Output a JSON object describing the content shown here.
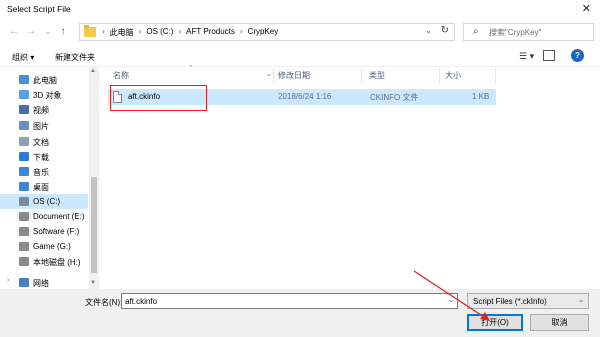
{
  "window": {
    "title": "Select Script File",
    "close_glyph": "✕"
  },
  "nav": {
    "back_glyph": "←",
    "forward_glyph": "→",
    "recent_glyph": "⌄",
    "up_glyph": "↑",
    "breadcrumbs": [
      "此电脑",
      "OS (C:)",
      "AFT Products",
      "CrypKey"
    ],
    "separator": "›",
    "dropdown_glyph": "⌄",
    "refresh_glyph": "↻",
    "search_placeholder": "搜索\"CrypKey\"",
    "search_glyph": "⌕"
  },
  "toolbar": {
    "organize_label": "组织 ▾",
    "new_folder_label": "新建文件夹",
    "views_glyph": "☰ ▾"
  },
  "sidebar": {
    "items": [
      {
        "label": "此电脑",
        "icon": "computer-icon",
        "color": "#4a90d9",
        "selected": false,
        "arrow": ""
      },
      {
        "label": "3D 对象",
        "icon": "3d-objects-icon",
        "color": "#5aa0e6",
        "selected": false,
        "arrow": ""
      },
      {
        "label": "视频",
        "icon": "video-icon",
        "color": "#4a6ea8",
        "selected": false,
        "arrow": ""
      },
      {
        "label": "图片",
        "icon": "pictures-icon",
        "color": "#6a8fbf",
        "selected": false,
        "arrow": ""
      },
      {
        "label": "文档",
        "icon": "documents-icon",
        "color": "#8ca0b8",
        "selected": false,
        "arrow": ""
      },
      {
        "label": "下载",
        "icon": "downloads-icon",
        "color": "#2b7bd8",
        "selected": false,
        "arrow": ""
      },
      {
        "label": "音乐",
        "icon": "music-icon",
        "color": "#3d86d9",
        "selected": false,
        "arrow": ""
      },
      {
        "label": "桌面",
        "icon": "desktop-icon",
        "color": "#3f86cf",
        "selected": false,
        "arrow": ""
      },
      {
        "label": "OS (C:)",
        "icon": "drive-icon",
        "color": "#7a8aa0",
        "selected": true,
        "arrow": ""
      },
      {
        "label": "Document (E:)",
        "icon": "drive-icon",
        "color": "#8a8a8a",
        "selected": false,
        "arrow": ""
      },
      {
        "label": "Software (F:)",
        "icon": "drive-icon",
        "color": "#8a8a8a",
        "selected": false,
        "arrow": ""
      },
      {
        "label": "Game (G:)",
        "icon": "drive-icon",
        "color": "#8a8a8a",
        "selected": false,
        "arrow": ""
      },
      {
        "label": "本地磁盘 (H:)",
        "icon": "drive-icon",
        "color": "#8a8a8a",
        "selected": false,
        "arrow": ""
      },
      {
        "label": "网络",
        "icon": "network-icon",
        "color": "#4a7fc0",
        "selected": false,
        "arrow": "›"
      }
    ]
  },
  "file_list": {
    "columns": [
      "名称",
      "修改日期",
      "类型",
      "大小"
    ],
    "rows": [
      {
        "name": "aft.ckinfo",
        "date": "2018/6/24 1:16",
        "type": "CKINFO 文件",
        "size": "1 KB",
        "selected": true
      }
    ]
  },
  "footer": {
    "filename_label": "文件名(N):",
    "filename_value": "aft.ckinfo",
    "filetype_value": "Script Files (*.ckInfo)",
    "dropdown_glyph": "⌄",
    "open_label": "打开(O)",
    "cancel_label": "取消"
  },
  "annotation_color": "#e02020",
  "accent": "#0078d7",
  "selection_color": "#cce8ff"
}
